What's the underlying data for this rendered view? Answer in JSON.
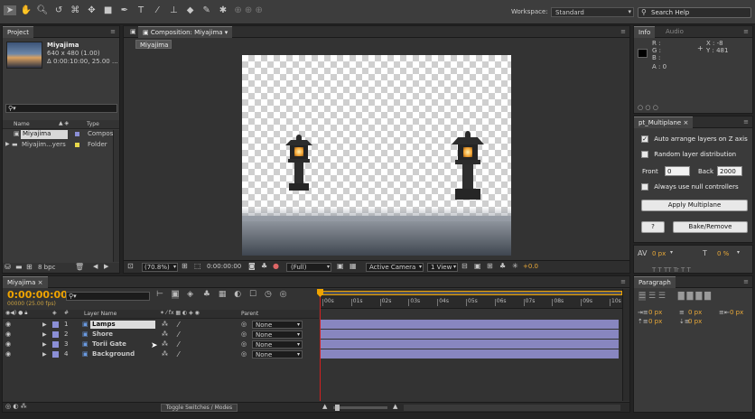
{
  "toolbar": {
    "workspace_label": "Workspace:",
    "workspace_value": "Standard",
    "search_placeholder": "Search Help"
  },
  "project": {
    "tab": "Project",
    "item_name": "Miyajima",
    "item_dims": "640 x 480 (1.00)",
    "item_duration": "Δ 0:00:10:00, 25.00 ...",
    "col_name": "Name",
    "col_type": "Type",
    "rows": [
      {
        "name": "Miyajima",
        "type": "Compos"
      },
      {
        "name": "Miyajim...yers",
        "type": "Folder"
      }
    ],
    "bpc": "8 bpc"
  },
  "composition": {
    "tab": "Composition: Miyajima",
    "subtab": "Miyajima",
    "zoom": "(70.8%)",
    "timecode": "0:00:00:00",
    "resolution": "(Full)",
    "camera": "Active Camera",
    "view": "1 View",
    "exposure": "+0.0"
  },
  "info": {
    "tab_info": "Info",
    "tab_audio": "Audio",
    "r": "R :",
    "g": "G :",
    "b": "B :",
    "a": "A : 0",
    "x": "X : -8",
    "y": "Y : 481"
  },
  "multiplane": {
    "tab": "pt_Multiplane",
    "opt_auto": "Auto arrange layers on Z axis",
    "opt_random": "Random layer distribution",
    "front_label": "Front",
    "front_value": "0",
    "back_label": "Back",
    "back_value": "2000",
    "opt_null": "Always use null controllers",
    "apply_btn": "Apply Multiplane",
    "help_btn": "?",
    "bake_btn": "Bake/Remove"
  },
  "align": {
    "px1": "0 px",
    "pct": "0 %"
  },
  "timeline": {
    "tab": "Miyajima",
    "timecode": "0:00:00:00",
    "fps": "00000 (25.00 fps)",
    "col_layer": "Layer Name",
    "col_parent": "Parent",
    "layers": [
      {
        "num": "1",
        "name": "Lamps",
        "parent": "None"
      },
      {
        "num": "2",
        "name": "Shore",
        "parent": "None"
      },
      {
        "num": "3",
        "name": "Torii Gate",
        "parent": "None"
      },
      {
        "num": "4",
        "name": "Background",
        "parent": "None"
      }
    ],
    "ruler": [
      "00s",
      "01s",
      "02s",
      "03s",
      "04s",
      "05s",
      "06s",
      "07s",
      "08s",
      "09s",
      "10s"
    ],
    "toggle_label": "Toggle Switches / Modes"
  },
  "paragraph": {
    "tab": "Paragraph",
    "v1": "0 px",
    "v2": "0 px",
    "v3": "0 px",
    "v4": "0 px",
    "v5": "0 px"
  },
  "colors": {
    "accent_orange": "#f0a400",
    "layer_label": "#8b8fd6",
    "bar_color": "#8886c0",
    "playhead": "#d02020"
  }
}
